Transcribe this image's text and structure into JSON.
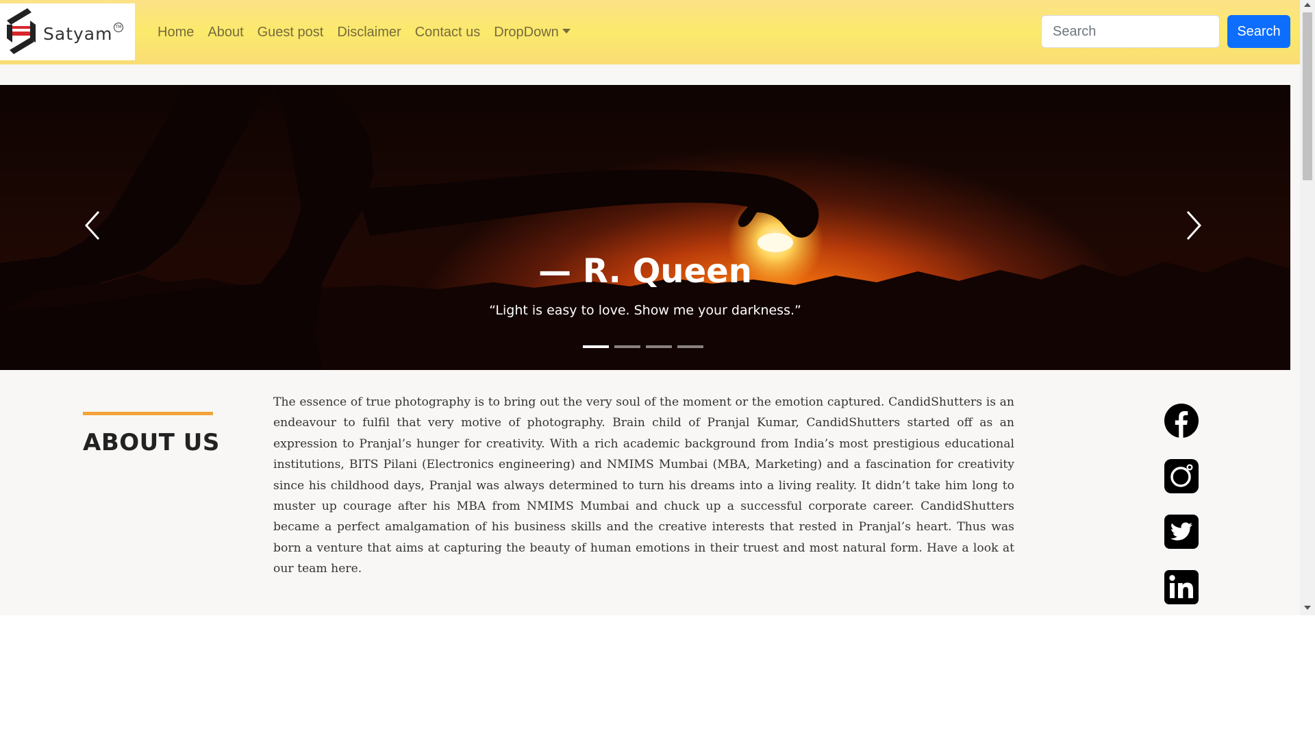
{
  "brand": {
    "logo_text": "Satyam",
    "logo_tm": "TM",
    "accent": "#f2a33a",
    "navbar_gradient": [
      "#fde187",
      "#fbea6b"
    ]
  },
  "nav": {
    "links": [
      "Home",
      "About",
      "Guest post",
      "Disclaimer",
      "Contact us",
      "DropDown"
    ],
    "search": {
      "placeholder": "Search",
      "button_label": "Search"
    }
  },
  "carousel": {
    "caption_title": "— R. Queen",
    "caption_text": "“Light is easy to love. Show me your darkness.”",
    "slide_count": 4,
    "active_slide": 1,
    "prev_icon": "chevron-left-icon",
    "next_icon": "chevron-right-icon"
  },
  "about": {
    "heading": "ABOUT US",
    "body": "The essence of true photography is to bring out the very soul of the moment or the emotion captured. CandidShutters is an endeavour to fulfil that very motive of photography. Brain child of Pranjal Kumar, CandidShutters started off as an expression to Pranjal’s hunger for creativity. With a rich academic background from India’s most prestigious educational institutions, BITS Pilani (Electronics engineering) and NMIMS Mumbai (MBA, Marketing) and a fascination for creativity since his childhood days, Pranjal was always determined to turn his dreams into a living reality. It didn’t take him long to muster up courage after his MBA from NMIMS Mumbai and chuck up a successful corporate career. CandidShutters became a perfect amalgamation of his business skills and the creative interests that rested in Pranjal’s heart. Thus was born a venture that aims at capturing the beauty of human emotions in their truest and most natural form. Have a look at our team here."
  },
  "social": [
    "facebook-icon",
    "instagram-icon",
    "twitter-icon",
    "linkedin-icon"
  ]
}
